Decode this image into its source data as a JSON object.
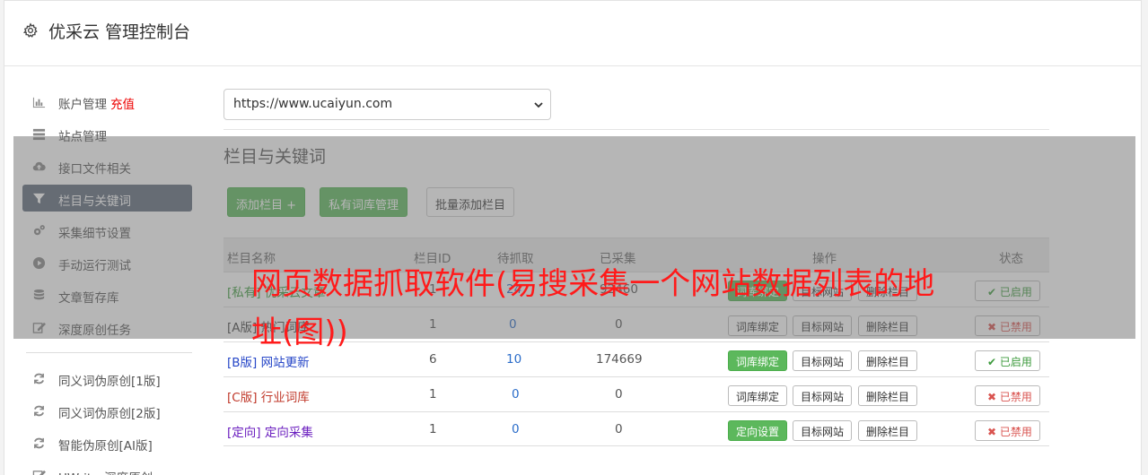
{
  "app": {
    "title": "优采云 管理控制台",
    "icon": "gear-icon"
  },
  "sidebar": {
    "items": [
      {
        "label": "账户管理",
        "extra": "充值",
        "icon": "bar-chart-icon",
        "active": false
      },
      {
        "label": "站点管理",
        "icon": "server-icon",
        "active": false
      },
      {
        "label": "接口文件相关",
        "icon": "cloud-upload-icon",
        "active": false
      },
      {
        "label": "栏目与关键词",
        "icon": "filter-icon",
        "active": true
      },
      {
        "label": "采集细节设置",
        "icon": "cogs-icon",
        "active": false
      },
      {
        "label": "手动运行测试",
        "icon": "play-circle-icon",
        "active": false
      },
      {
        "label": "文章暂存库",
        "icon": "database-icon",
        "active": false
      },
      {
        "label": "深度原创任务",
        "icon": "edit-icon",
        "active": false
      },
      {
        "label": "同义词伪原创[1版]",
        "icon": "refresh-icon",
        "active": false
      },
      {
        "label": "同义词伪原创[2版]",
        "icon": "refresh-icon",
        "active": false
      },
      {
        "label": "智能伪原创[AI版]",
        "icon": "refresh-icon",
        "active": false
      },
      {
        "label": "UWriter深度原创",
        "icon": "edit-icon",
        "active": false
      }
    ]
  },
  "site_select": {
    "value": "https://www.ucaiyun.com"
  },
  "section": {
    "title": "栏目与关键词"
  },
  "toolbar": {
    "add_column": "添加栏目 +",
    "private_lexicon": "私有词库管理",
    "batch_add": "批量添加栏目"
  },
  "table": {
    "headers": {
      "name": "栏目名称",
      "id": "栏目ID",
      "pending": "待抓取",
      "collected": "已采集",
      "ops": "操作",
      "status": "状态"
    },
    "rows": [
      {
        "tag": "[私有]",
        "name": "优采云文章",
        "color": "green",
        "id": "1",
        "pending": "24",
        "collected": "92460",
        "op1": "词库绑定",
        "op1_style": "green",
        "op2": "目标网站",
        "op3": "删除栏目",
        "status": "已启用",
        "enabled": true
      },
      {
        "tag": "[A版]",
        "name": "热门词库",
        "color": "dark",
        "id": "1",
        "pending": "0",
        "collected": "0",
        "op1": "词库绑定",
        "op1_style": "white",
        "op2": "目标网站",
        "op3": "删除栏目",
        "status": "已禁用",
        "enabled": false
      },
      {
        "tag": "[B版]",
        "name": "网站更新",
        "color": "blue",
        "id": "6",
        "pending": "10",
        "collected": "174669",
        "op1": "词库绑定",
        "op1_style": "green",
        "op2": "目标网站",
        "op3": "删除栏目",
        "status": "已启用",
        "enabled": true
      },
      {
        "tag": "[C版]",
        "name": "行业词库",
        "color": "red",
        "id": "1",
        "pending": "0",
        "collected": "0",
        "op1": "词库绑定",
        "op1_style": "white",
        "op2": "目标网站",
        "op3": "删除栏目",
        "status": "已禁用",
        "enabled": false
      },
      {
        "tag": "[定向]",
        "name": "定向采集",
        "color": "purple",
        "id": "1",
        "pending": "0",
        "collected": "0",
        "op1": "定向设置",
        "op1_style": "green",
        "op2": "目标网站",
        "op3": "删除栏目",
        "status": "已禁用",
        "enabled": false
      }
    ]
  },
  "watermark": {
    "text": "网页数据抓取软件(易搜采集一个网站数据列表的地址(图))"
  },
  "colors": {
    "active_nav": "#5f6b7a",
    "primary_green": "#5cb85c",
    "danger": "#d9534f",
    "watermark": "#ff1a1a"
  }
}
